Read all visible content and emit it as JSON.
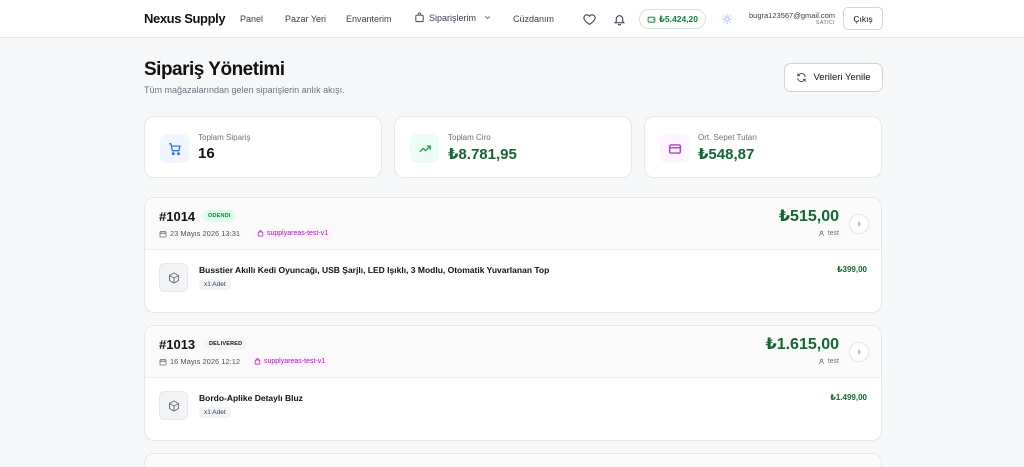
{
  "nav": {
    "brand": "Nexus Supply",
    "links": [
      "Panel",
      "Pazar Yeri",
      "Envanterim",
      "Siparişlerim",
      "Cüzdanım"
    ],
    "balance": "₺5.424,20",
    "user_email": "bugra123567@gmail.com",
    "user_role": "SATICI",
    "logout": "Çıkış"
  },
  "header": {
    "title": "Sipariş Yönetimi",
    "subtitle": "Tüm mağazalarından gelen siparişlerin anlık akışı.",
    "refresh": "Verileri Yenile"
  },
  "stats": [
    {
      "label": "Toplam Sipariş",
      "value": "16",
      "icon": "cart-icon"
    },
    {
      "label": "Toplam Ciro",
      "value": "₺8.781,95",
      "icon": "trending-up-icon"
    },
    {
      "label": "Ort. Sepet Tutarı",
      "value": "₺548,87",
      "icon": "credit-card-icon"
    }
  ],
  "orders": [
    {
      "id": "#1014",
      "status": "ODENDI",
      "date": "23 Mayıs 2026 13:31",
      "store": "supplyareas-test-v1",
      "total": "₺515,00",
      "user": "test",
      "items": [
        {
          "name": "Busstier Akıllı Kedi Oyuncağı, USB Şarjlı, LED Işıklı, 3 Modlu, Otomatik Yuvarlanan Top",
          "qty": "x1 Adet",
          "price": "₺399,00"
        }
      ]
    },
    {
      "id": "#1013",
      "status": "DELIVERED",
      "date": "16 Mayıs 2026 12:12",
      "store": "supplyareas-test-v1",
      "total": "₺1.615,00",
      "user": "test",
      "items": [
        {
          "name": "Bordo-Aplike Detaylı Bluz",
          "qty": "x1 Adet",
          "price": "₺1.499,00"
        }
      ]
    }
  ],
  "colors": {
    "accent_green": "#166534",
    "badge_green_bg": "#dcfce7",
    "store_purple": "#a21caf",
    "cart_icon_bg": "#eff6ff",
    "trend_icon_bg": "#ecfdf5",
    "card_icon_bg": "#fdf4ff"
  }
}
